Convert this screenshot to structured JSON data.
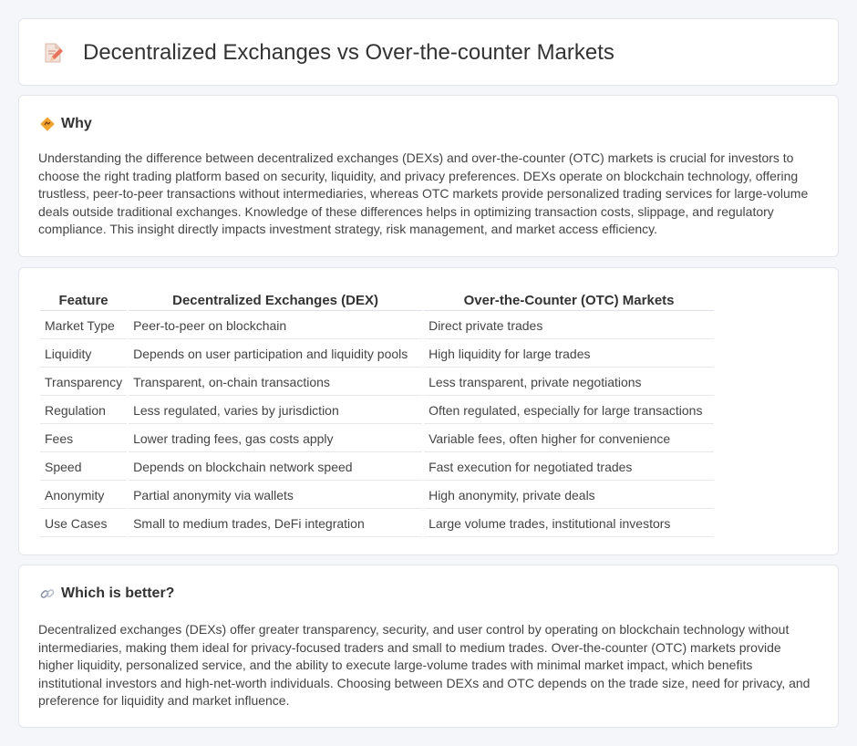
{
  "header": {
    "title": "Decentralized Exchanges vs Over-the-counter Markets",
    "icon": "document-pencil-icon"
  },
  "why": {
    "heading": "Why",
    "icon": "diamond-sign-icon",
    "text": "Understanding the difference between decentralized exchanges (DEXs) and over-the-counter (OTC) markets is crucial for investors to choose the right trading platform based on security, liquidity, and privacy preferences. DEXs operate on blockchain technology, offering trustless, peer-to-peer transactions without intermediaries, whereas OTC markets provide personalized trading services for large-volume deals outside traditional exchanges. Knowledge of these differences helps in optimizing transaction costs, slippage, and regulatory compliance. This insight directly impacts investment strategy, risk management, and market access efficiency."
  },
  "comparison": {
    "headers": [
      "Feature",
      "Decentralized Exchanges (DEX)",
      "Over-the-Counter (OTC) Markets"
    ],
    "rows": [
      [
        "Market Type",
        "Peer-to-peer on blockchain",
        "Direct private trades"
      ],
      [
        "Liquidity",
        "Depends on user participation and liquidity pools",
        "High liquidity for large trades"
      ],
      [
        "Transparency",
        "Transparent, on-chain transactions",
        "Less transparent, private negotiations"
      ],
      [
        "Regulation",
        "Less regulated, varies by jurisdiction",
        "Often regulated, especially for large transactions"
      ],
      [
        "Fees",
        "Lower trading fees, gas costs apply",
        "Variable fees, often higher for convenience"
      ],
      [
        "Speed",
        "Depends on blockchain network speed",
        "Fast execution for negotiated trades"
      ],
      [
        "Anonymity",
        "Partial anonymity via wallets",
        "High anonymity, private deals"
      ],
      [
        "Use Cases",
        "Small to medium trades, DeFi integration",
        "Large volume trades, institutional investors"
      ]
    ]
  },
  "better": {
    "heading": "Which is better?",
    "icon": "link-icon",
    "text": "Decentralized exchanges (DEXs) offer greater transparency, security, and user control by operating on blockchain technology without intermediaries, making them ideal for privacy-focused traders and small to medium trades. Over-the-counter (OTC) markets provide higher liquidity, personalized service, and the ability to execute large-volume trades with minimal market impact, which benefits institutional investors and high-net-worth individuals. Choosing between DEXs and OTC depends on the trade size, need for privacy, and preference for liquidity and market influence."
  }
}
